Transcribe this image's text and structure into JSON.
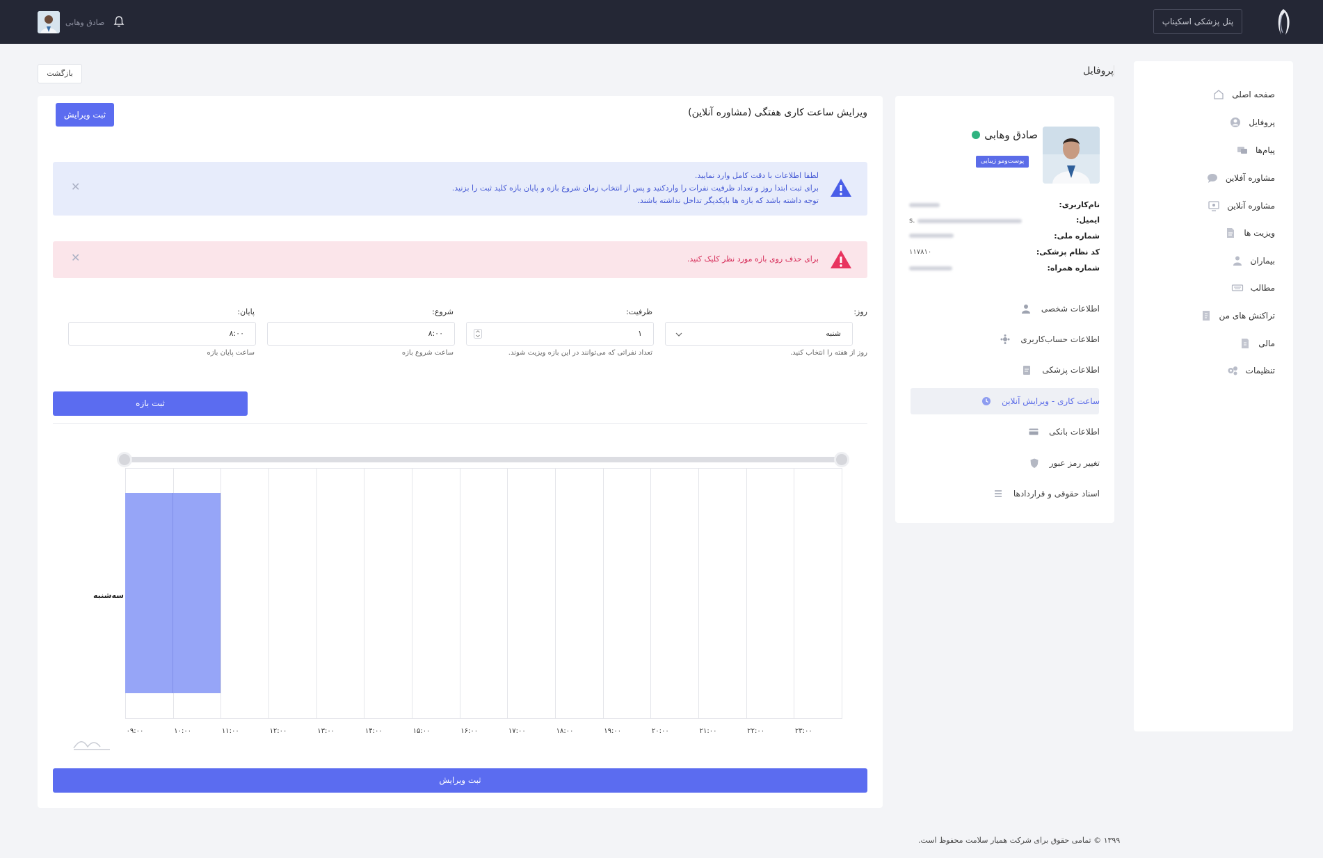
{
  "header": {
    "panel_button": "پنل پزشکی اسکیناپ",
    "user_name": "صادق وهابی"
  },
  "sidebar": {
    "items": [
      {
        "label": "صفحه اصلی",
        "icon": "home-icon"
      },
      {
        "label": "پروفایل",
        "icon": "user-circle-icon"
      },
      {
        "label": "پیام‌ها",
        "icon": "messages-icon"
      },
      {
        "label": "مشاوره آفلاین",
        "icon": "chat-bubble-icon"
      },
      {
        "label": "مشاوره آنلاین",
        "icon": "monitor-icon"
      },
      {
        "label": "ویزیت ها",
        "icon": "document-icon"
      },
      {
        "label": "بیماران",
        "icon": "patient-icon"
      },
      {
        "label": "مطالب",
        "icon": "keyboard-icon"
      },
      {
        "label": "تراکنش های من",
        "icon": "receipt-icon"
      },
      {
        "label": "مالی",
        "icon": "wallet-icon"
      },
      {
        "label": "تنظیمات",
        "icon": "gears-icon"
      }
    ]
  },
  "page": {
    "title": "پروفایل",
    "back_label": "بازگشت"
  },
  "profile": {
    "name": "صادق وهابی",
    "badge": "پوست‌ومو زیبایی",
    "fields": {
      "username_label": "نام‌کاربری:",
      "email_label": "ایمیل:",
      "email_prefix": "s.",
      "national_id_label": "شماره ملی:",
      "medical_code_label": "کد نظام پزشکی:",
      "medical_code_value": "۱۱۷۸۱۰",
      "mobile_label": "شماره همراه:"
    },
    "menu": [
      {
        "label": "اطلاعات شخصی",
        "icon": "person-icon"
      },
      {
        "label": "اطلاعات حساب‌کاربری",
        "icon": "account-gear-icon"
      },
      {
        "label": "اطلاعات پزشکی",
        "icon": "clipboard-icon"
      },
      {
        "label": "ساعت کاری - ویرایش آنلاین",
        "icon": "clock-icon"
      },
      {
        "label": "اطلاعات بانکی",
        "icon": "credit-card-icon"
      },
      {
        "label": "تغییر رمز عبور",
        "icon": "shield-icon"
      },
      {
        "label": "اسناد حقوقی و قراردادها",
        "icon": "list-icon"
      }
    ]
  },
  "editor": {
    "title": "ویرایش ساعت کاری هفتگی (مشاوره آنلاین)",
    "submit_top": "ثبت ویرایش",
    "info_alert": {
      "line1": "لطفا اطلاعات با دقت کامل وارد نمایید.",
      "line2": "برای ثبت ابتدا روز و تعداد ظرفیت نفرات را واردکنید و پس از انتخاب زمان شروع بازه و پایان بازه کلید ثبت را بزنید.",
      "line3": "توجه داشته باشد که بازه ها بایکدیگر تداخل نداشته باشند."
    },
    "danger_alert": "برای حذف روی بازه مورد نظر کلیک کنید.",
    "form": {
      "day_label": "روز:",
      "day_value": "شنبه",
      "day_help": "روز از هفته را انتخاب کنید.",
      "capacity_label": "ظرفیت:",
      "capacity_value": "۱",
      "capacity_help": "تعداد نفراتی که می‌توانند در این بازه ویزیت شوند.",
      "start_label": "شروع:",
      "start_value": "۸:۰۰",
      "start_help": "ساعت شروع بازه",
      "end_label": "پایان:",
      "end_value": "۸:۰۰",
      "end_help": "ساعت پایان بازه"
    },
    "add_range_button": "ثبت بازه",
    "submit_bottom": "ثبت ویرایش"
  },
  "chart_data": {
    "type": "bar",
    "orientation": "timeline",
    "x_ticks": [
      "۰۹:۰۰",
      "۱۰:۰۰",
      "۱۱:۰۰",
      "۱۲:۰۰",
      "۱۳:۰۰",
      "۱۴:۰۰",
      "۱۵:۰۰",
      "۱۶:۰۰",
      "۱۷:۰۰",
      "۱۸:۰۰",
      "۱۹:۰۰",
      "۲۰:۰۰",
      "۲۱:۰۰",
      "۲۲:۰۰",
      "۲۳:۰۰"
    ],
    "rows": [
      "سه‌شنبه"
    ],
    "ranges": [
      {
        "row": "سه‌شنبه",
        "start": "09:00",
        "end": "10:00"
      },
      {
        "row": "سه‌شنبه",
        "start": "10:00",
        "end": "11:00"
      }
    ],
    "bar_color": "#96a5f7"
  },
  "footer": {
    "copyright": "۱۳۹۹ © تمامی حقوق برای شرکت همیار سلامت محفوظ است."
  }
}
